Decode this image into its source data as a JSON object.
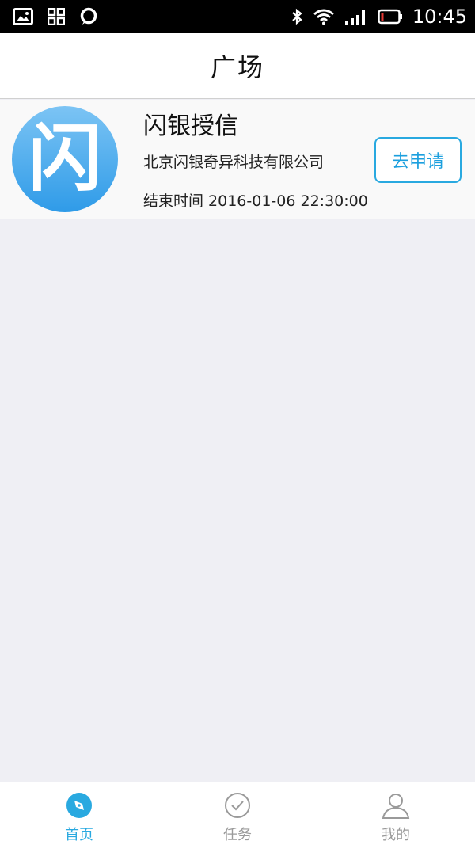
{
  "status_bar": {
    "time": "10:45",
    "icons": [
      "image-icon",
      "apps-icon",
      "chat-icon",
      "bluetooth-icon",
      "wifi-icon",
      "signal-icon",
      "battery-icon"
    ]
  },
  "header": {
    "title": "广场"
  },
  "card": {
    "logo_char": "闪",
    "title": "闪银授信",
    "company": "北京闪银奇异科技有限公司",
    "end_time": "结束时间 2016-01-06 22:30:00",
    "apply_label": "去申请"
  },
  "tabs": [
    {
      "label": "首页",
      "icon": "compass-icon",
      "active": true
    },
    {
      "label": "任务",
      "icon": "check-circle-icon",
      "active": false
    },
    {
      "label": "我的",
      "icon": "user-icon",
      "active": false
    }
  ],
  "colors": {
    "accent": "#29a9e0",
    "inactive": "#9a9a9a",
    "background": "#efeff4"
  }
}
